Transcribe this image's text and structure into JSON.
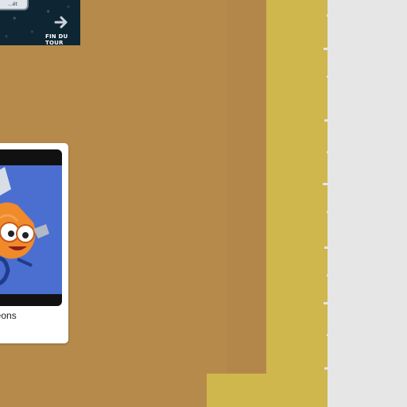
{
  "tour": {
    "chip_text": "...ét",
    "end_label": "FIN DU TOUR",
    "arrow_icon": "arrow-right-icon"
  },
  "card": {
    "title": "geons",
    "image_icon": "monster-character-illustration"
  },
  "colors": {
    "board_brown": "#b68a4b",
    "board_yellow": "#cfb64d",
    "panel_dark": "#0e2633",
    "card_art_blue": "#4a6fd1"
  }
}
